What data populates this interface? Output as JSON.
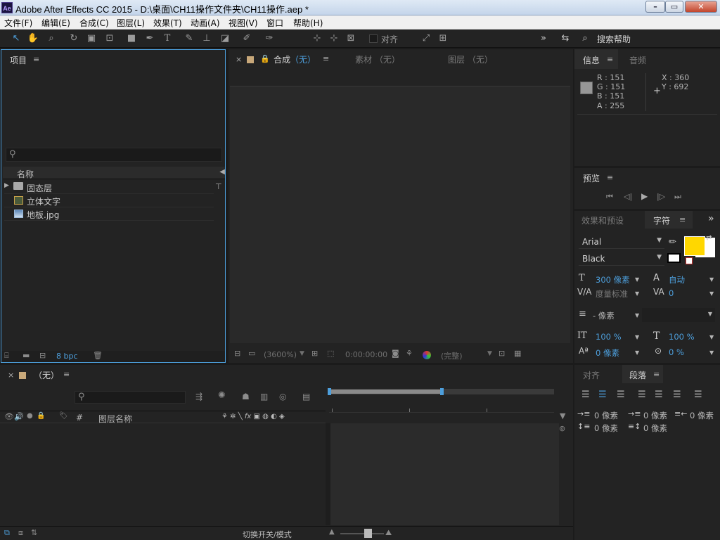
{
  "window": {
    "title": "Adobe After Effects CC 2015 - D:\\桌面\\CH11操作文件夹\\CH11操作.aep *",
    "app_icon": "Ae"
  },
  "menu": [
    "文件(F)",
    "编辑(E)",
    "合成(C)",
    "图层(L)",
    "效果(T)",
    "动画(A)",
    "视图(V)",
    "窗口",
    "帮助(H)"
  ],
  "toolbar": {
    "align_label": "对齐",
    "search_help": "搜索帮助"
  },
  "project": {
    "title": "项目",
    "column_name": "名称",
    "items": [
      "固态层",
      "立体文字",
      "地板.jpg"
    ],
    "bpc": "8 bpc"
  },
  "comp": {
    "tab_comp_label": "合成",
    "tab_comp_value": "（无）",
    "tab_footage": "素材 （无）",
    "tab_layer": "图层 （无）",
    "zoom": "(3600%)",
    "timecode": "0:00:00:00",
    "quality": "(完整)"
  },
  "info": {
    "title": "信息",
    "tab_audio": "音频",
    "r": "R : 151",
    "g": "G : 151",
    "b": "B : 151",
    "a": "A : 255",
    "x": "X : 360",
    "y": "Y : 692",
    "swatch_color": "#979797"
  },
  "preview": {
    "title": "预览"
  },
  "character": {
    "tab_effects": "效果和预设",
    "title": "字符",
    "font": "Arial",
    "style": "Black",
    "fill_color": "#ffd700",
    "size": "300 像素",
    "leading": "自动",
    "kerning": "度量标准",
    "tracking": "0",
    "stroke": "- 像素",
    "vscale": "100 %",
    "hscale": "100 %",
    "baseline": "0 像素",
    "tsume": "0 %"
  },
  "timeline": {
    "title": "（无）",
    "col_layer_name": "图层名称",
    "col_hash": "#",
    "toggle_label": "切换开关/模式"
  },
  "paragraph": {
    "tab_align": "对齐",
    "title": "段落",
    "indent_left": "0 像素",
    "indent_right": "0 像素",
    "indent_first": "0 像素",
    "space_before": "0 像素",
    "space_after": "0 像素"
  }
}
